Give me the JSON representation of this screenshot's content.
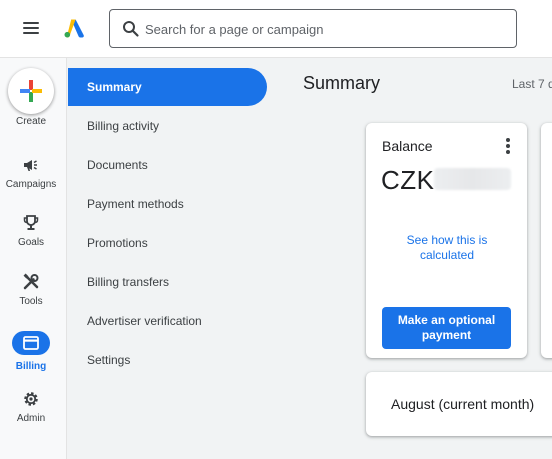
{
  "topbar": {
    "search_placeholder": "Search for a page or campaign"
  },
  "rail": {
    "create_label": "Create",
    "items": [
      {
        "label": "Campaigns",
        "icon": "megaphone-icon"
      },
      {
        "label": "Goals",
        "icon": "trophy-icon"
      },
      {
        "label": "Tools",
        "icon": "tools-icon"
      },
      {
        "label": "Billing",
        "icon": "credit-card-icon",
        "active": true
      },
      {
        "label": "Admin",
        "icon": "gear-icon"
      }
    ]
  },
  "subnav": {
    "items": [
      {
        "label": "Summary",
        "active": true
      },
      {
        "label": "Billing activity"
      },
      {
        "label": "Documents"
      },
      {
        "label": "Payment methods"
      },
      {
        "label": "Promotions"
      },
      {
        "label": "Billing transfers"
      },
      {
        "label": "Advertiser verification"
      },
      {
        "label": "Settings"
      }
    ]
  },
  "main": {
    "title": "Summary",
    "date_range": "Last 7 d",
    "balance_card": {
      "title": "Balance",
      "currency": "CZK",
      "link": "See how this is calculated",
      "button": "Make an optional payment"
    },
    "month_card": {
      "title": "August (current month)"
    }
  },
  "colors": {
    "accent": "#1a73e8",
    "background": "#f1f3f4"
  }
}
